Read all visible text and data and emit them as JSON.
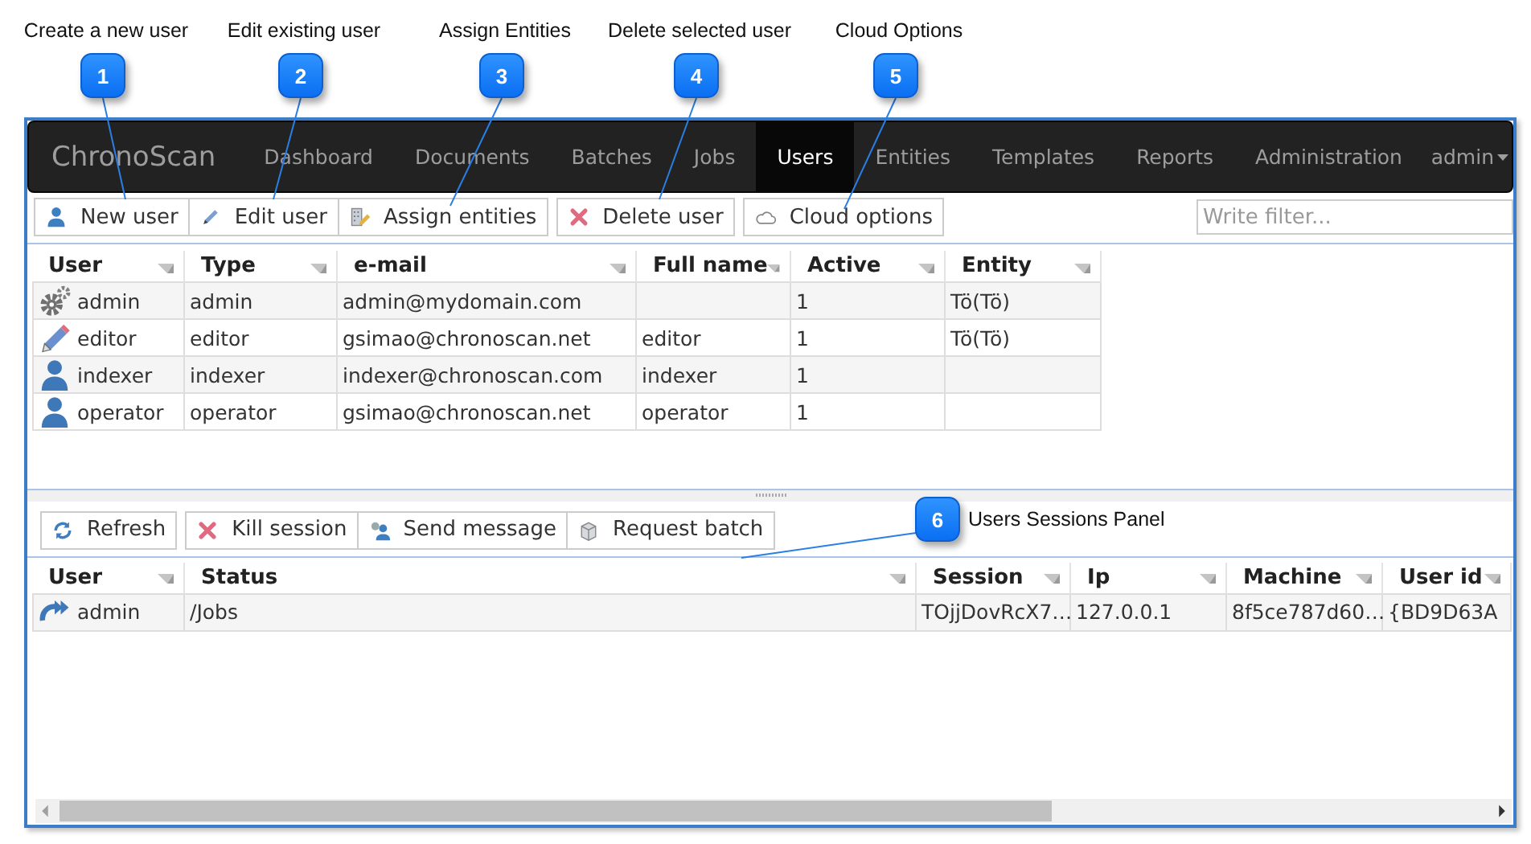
{
  "callouts": [
    {
      "kind": "top",
      "number": "1",
      "label": "Create a new user"
    },
    {
      "kind": "top",
      "number": "2",
      "label": "Edit existing user"
    },
    {
      "kind": "top",
      "number": "3",
      "label": "Assign Entities"
    },
    {
      "kind": "top",
      "number": "4",
      "label": "Delete selected user"
    },
    {
      "kind": "top",
      "number": "5",
      "label": "Cloud Options"
    },
    {
      "kind": "side",
      "number": "6",
      "label": "Users Sessions Panel"
    }
  ],
  "navbar": {
    "brand": "ChronoScan",
    "items": [
      {
        "label": "Dashboard",
        "selected": false
      },
      {
        "label": "Documents",
        "selected": false
      },
      {
        "label": "Batches",
        "selected": false
      },
      {
        "label": "Jobs",
        "selected": false
      },
      {
        "label": "Users",
        "selected": true
      },
      {
        "label": "Entities",
        "selected": false
      },
      {
        "label": "Templates",
        "selected": false
      },
      {
        "label": "Reports",
        "selected": false
      },
      {
        "label": "Administration",
        "selected": false
      }
    ],
    "user_menu": "admin"
  },
  "users_toolbar": {
    "groups": [
      [
        {
          "kind": "user",
          "label": "New user"
        },
        {
          "kind": "edit",
          "label": "Edit user"
        },
        {
          "kind": "assign",
          "label": "Assign entities"
        }
      ],
      [
        {
          "kind": "delete",
          "label": "Delete user"
        }
      ],
      [
        {
          "kind": "cloud",
          "label": "Cloud options"
        }
      ]
    ],
    "filter": {
      "placeholder": "Write filter..."
    }
  },
  "users_table": {
    "columns": [
      "User",
      "Type",
      "e-mail",
      "Full name",
      "Active",
      "Entity"
    ],
    "rows": [
      {
        "kind": "gear",
        "cells": [
          "admin",
          "admin",
          "admin@mydomain.com",
          "",
          "1",
          "Tö(Tö)"
        ]
      },
      {
        "kind": "pencil",
        "cells": [
          "editor",
          "editor",
          "gsimao@chronoscan.net",
          "editor",
          "1",
          "Tö(Tö)"
        ]
      },
      {
        "kind": "person",
        "cells": [
          "indexer",
          "indexer",
          "indexer@chronoscan.com",
          "indexer",
          "1",
          ""
        ]
      },
      {
        "kind": "person",
        "cells": [
          "operator",
          "operator",
          "gsimao@chronoscan.net",
          "operator",
          "1",
          ""
        ]
      }
    ]
  },
  "sessions_toolbar": {
    "groups": [
      [
        {
          "kind": "refresh",
          "label": "Refresh"
        }
      ],
      [
        {
          "kind": "delete",
          "label": "Kill session"
        },
        {
          "kind": "message",
          "label": "Send message"
        },
        {
          "kind": "batch",
          "label": "Request batch"
        }
      ]
    ]
  },
  "sessions_table": {
    "columns": [
      "User",
      "Status",
      "Session",
      "Ip",
      "Machine",
      "User id"
    ],
    "rows": [
      {
        "kind": "session",
        "cells": [
          "admin",
          "/Jobs",
          "TOjjDovRcX7…",
          "127.0.0.1",
          "8f5ce787d60…",
          "{BD9D63A"
        ]
      }
    ]
  }
}
